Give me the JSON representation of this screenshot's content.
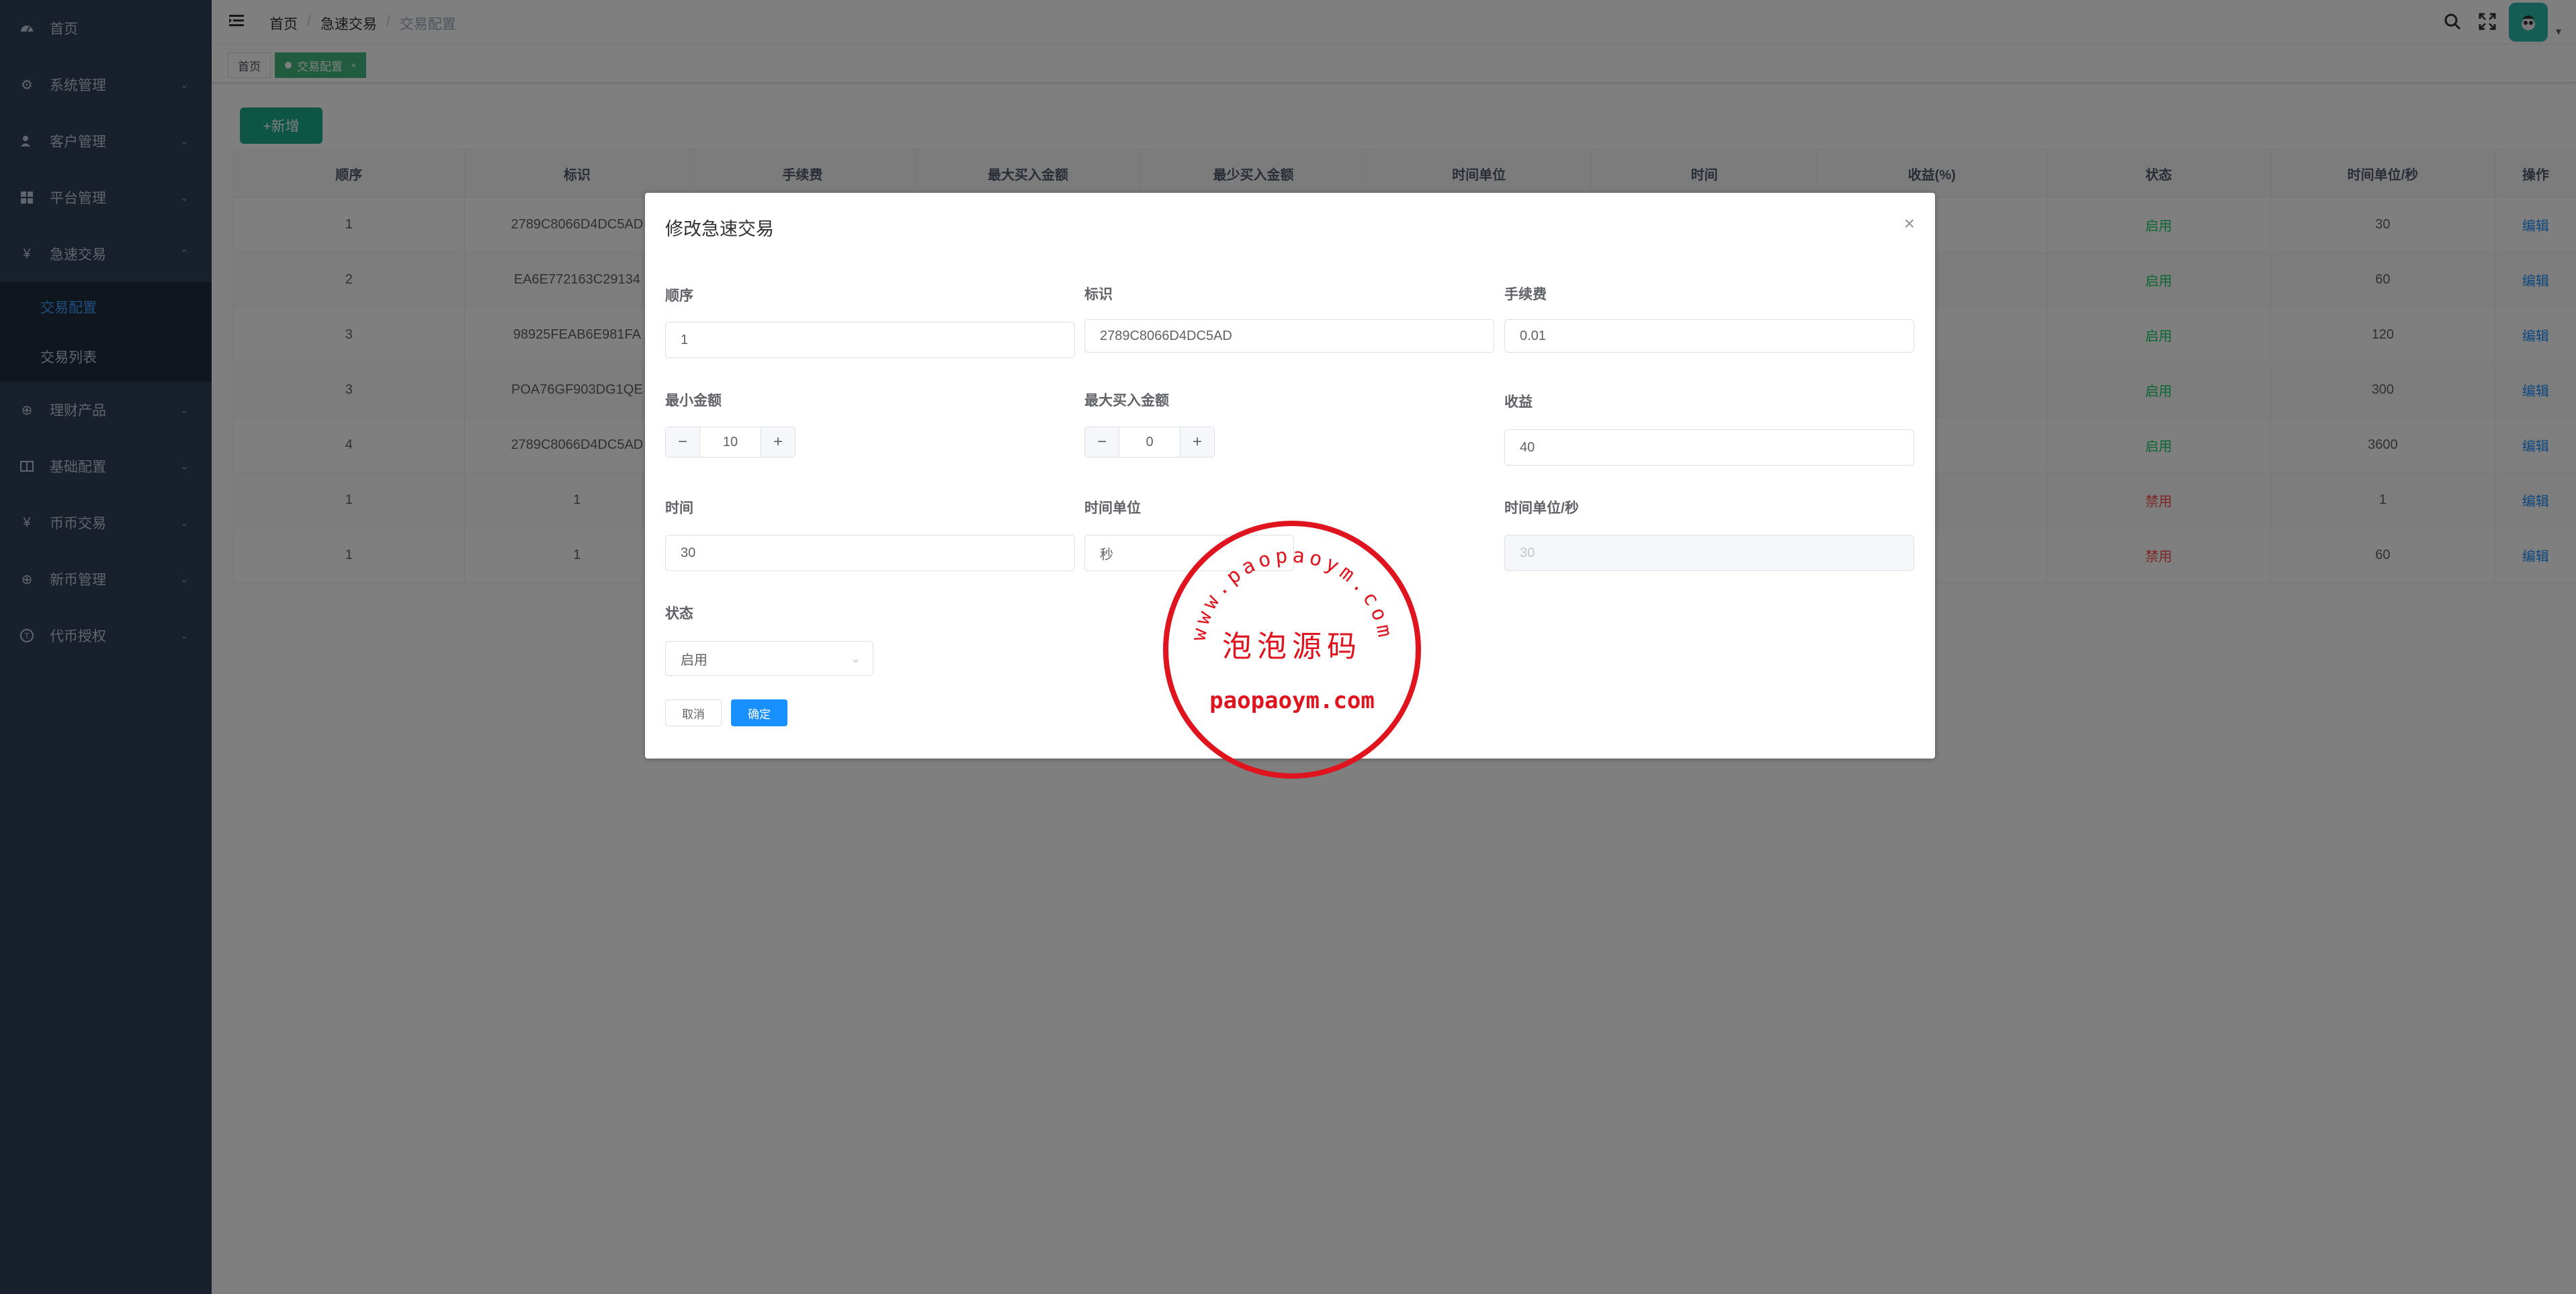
{
  "sidebar": {
    "items": [
      {
        "label": "首页",
        "icon": "dashboard-icon"
      },
      {
        "label": "系统管理",
        "icon": "gear-icon"
      },
      {
        "label": "客户管理",
        "icon": "user-icon"
      },
      {
        "label": "平台管理",
        "icon": "grid-icon"
      },
      {
        "label": "急速交易",
        "icon": "yen-icon"
      },
      {
        "label": "理财产品",
        "icon": "plus-circle-icon"
      },
      {
        "label": "基础配置",
        "icon": "book-icon"
      },
      {
        "label": "币币交易",
        "icon": "yen-icon"
      },
      {
        "label": "新币管理",
        "icon": "plus-circle-icon"
      },
      {
        "label": "代币授权",
        "icon": "coin-icon"
      }
    ],
    "submenu": [
      {
        "label": "交易配置",
        "active": true
      },
      {
        "label": "交易列表",
        "active": false
      }
    ]
  },
  "breadcrumb": [
    "首页",
    "急速交易",
    "交易配置"
  ],
  "tags": [
    {
      "label": "首页",
      "active": false
    },
    {
      "label": "交易配置",
      "active": true
    }
  ],
  "toolbar": {
    "add_label": "+新增"
  },
  "table": {
    "headers": [
      "顺序",
      "标识",
      "手续费",
      "最大买入金额",
      "最少买入金额",
      "时间单位",
      "时间",
      "收益(%)",
      "状态",
      "时间单位/秒",
      "操作"
    ],
    "rows": [
      {
        "order": "1",
        "id": "2789C8066D4DC5AD",
        "status": "启用",
        "seconds": "30",
        "op": "编辑"
      },
      {
        "order": "2",
        "id": "EA6E772163C29134",
        "status": "启用",
        "seconds": "60",
        "op": "编辑"
      },
      {
        "order": "3",
        "id": "98925FEAB6E981FA",
        "status": "启用",
        "seconds": "120",
        "op": "编辑"
      },
      {
        "order": "3",
        "id": "POA76GF903DG1QE",
        "status": "启用",
        "seconds": "300",
        "op": "编辑"
      },
      {
        "order": "4",
        "id": "2789C8066D4DC5AD",
        "status": "启用",
        "seconds": "3600",
        "op": "编辑"
      },
      {
        "order": "1",
        "id": "1",
        "status": "禁用",
        "seconds": "1",
        "op": "编辑"
      },
      {
        "order": "1",
        "id": "1",
        "status": "禁用",
        "seconds": "60",
        "op": "编辑"
      }
    ]
  },
  "dialog": {
    "title": "修改急速交易",
    "fields": {
      "order": {
        "label": "顺序",
        "value": "1"
      },
      "identifier": {
        "label": "标识",
        "value": "2789C8066D4DC5AD"
      },
      "fee": {
        "label": "手续费",
        "value": "0.01"
      },
      "min_amount": {
        "label": "最小金额",
        "value": "10"
      },
      "max_amount": {
        "label": "最大买入金额",
        "value": "0"
      },
      "profit": {
        "label": "收益",
        "value": "40"
      },
      "time": {
        "label": "时间",
        "value": "30"
      },
      "time_unit": {
        "label": "时间单位",
        "value": "秒"
      },
      "time_unit_seconds": {
        "label": "时间单位/秒",
        "value": "30"
      },
      "status": {
        "label": "状态",
        "value": "启用"
      }
    },
    "cancel_label": "取消",
    "ok_label": "确定"
  },
  "watermark": {
    "top_text": "www.paopaoym.com",
    "center_text": "泡泡源码",
    "bottom_text": "paopaoym.com"
  },
  "colors": {
    "sidebar_bg": "#304156",
    "accent": "#1890ff",
    "tag_active": "#42b983",
    "enabled": "#13ce66",
    "disabled": "#ff4949",
    "stamp": "#e0141e"
  }
}
